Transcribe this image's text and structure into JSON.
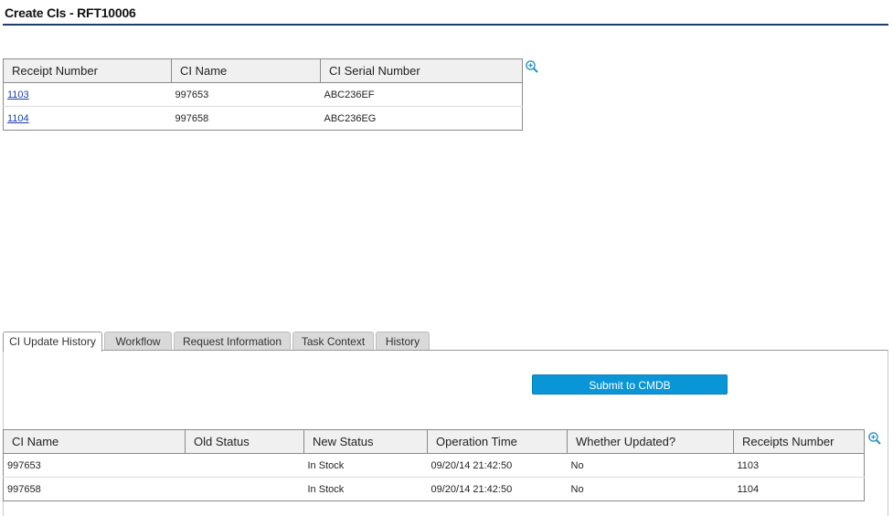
{
  "page": {
    "title": "Create CIs - RFT10006"
  },
  "receipts_table": {
    "columns": [
      "Receipt Number",
      "CI Name",
      "CI Serial Number"
    ],
    "rows": [
      {
        "receipt_number": "1103",
        "ci_name": "997653",
        "ci_serial": "ABC236EF"
      },
      {
        "receipt_number": "1104",
        "ci_name": "997658",
        "ci_serial": "ABC236EG"
      }
    ]
  },
  "tabs": [
    {
      "label": "CI Update History",
      "active": true
    },
    {
      "label": "Workflow",
      "active": false
    },
    {
      "label": "Request Information",
      "active": false
    },
    {
      "label": "Task Context",
      "active": false
    },
    {
      "label": "History",
      "active": false
    }
  ],
  "submit_button": {
    "label": "Submit to CMDB"
  },
  "history_table": {
    "columns": [
      "CI Name",
      "Old Status",
      "New Status",
      "Operation Time",
      "Whether Updated?",
      "Receipts Number"
    ],
    "rows": [
      {
        "ci_name": "997653",
        "old_status": "",
        "new_status": "In Stock",
        "operation_time": "09/20/14 21:42:50",
        "updated": "No",
        "receipts_number": "1103"
      },
      {
        "ci_name": "997658",
        "old_status": "",
        "new_status": "In Stock",
        "operation_time": "09/20/14 21:42:50",
        "updated": "No",
        "receipts_number": "1104"
      }
    ]
  },
  "icons": {
    "zoom": "zoom-in-icon"
  },
  "colors": {
    "accent": "#0a96d6",
    "title_rule": "#1f3d6b",
    "link": "#1a3fb0"
  }
}
